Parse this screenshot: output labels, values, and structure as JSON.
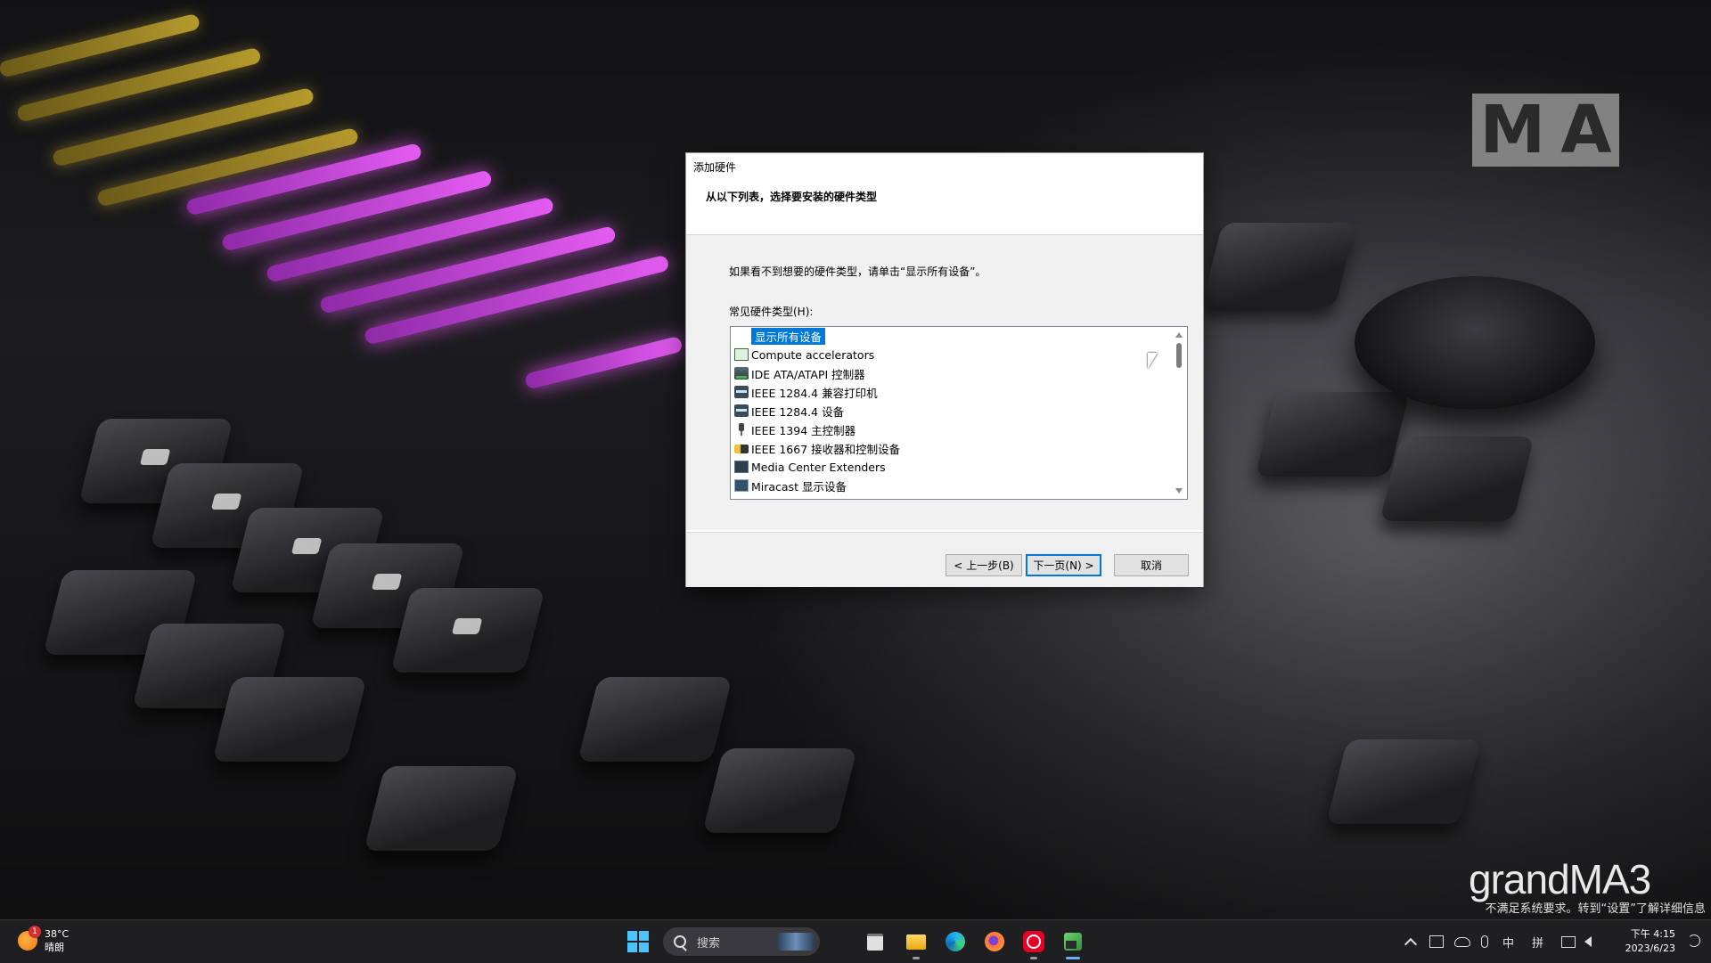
{
  "dialog": {
    "title": "添加硬件",
    "heading": "从以下列表，选择要安装的硬件类型",
    "hint": "如果看不到想要的硬件类型，请单击“显示所有设备”。",
    "list_label": "常见硬件类型(H):",
    "items": [
      {
        "label": "显示所有设备",
        "icon": "none",
        "selected": true
      },
      {
        "label": "Compute accelerators",
        "icon": "chip-box-icon"
      },
      {
        "label": "IDE ATA/ATAPI 控制器",
        "icon": "controller-card-icon"
      },
      {
        "label": "IEEE 1284.4 兼容打印机",
        "icon": "printer-icon"
      },
      {
        "label": "IEEE 1284.4 设备",
        "icon": "printer-icon"
      },
      {
        "label": "IEEE 1394 主控制器",
        "icon": "plug-icon"
      },
      {
        "label": "IEEE 1667 接收器和控制设备",
        "icon": "remote-icon"
      },
      {
        "label": "Media Center Extenders",
        "icon": "monitor-icon"
      },
      {
        "label": "Miracast 显示设备",
        "icon": "cast-display-icon"
      }
    ],
    "buttons": {
      "back": "< 上一步(B)",
      "next": "下一页(N) >",
      "cancel": "取消"
    }
  },
  "wallpaper": {
    "logo": [
      "M",
      "A"
    ],
    "brand_text": "grandMA3",
    "activation_notice": "不满足系统要求。转到“设置”了解详细信息"
  },
  "taskbar": {
    "weather": {
      "badge": "1",
      "temp": "38°C",
      "condition": "晴朗"
    },
    "search_placeholder": "搜索",
    "tray": {
      "ime_lang": "中",
      "ime_mode": "拼"
    },
    "clock": {
      "time": "下午 4:15",
      "date": "2023/6/23"
    }
  },
  "colors": {
    "selection": "#0078d7",
    "accent": "#4cc2ff"
  }
}
